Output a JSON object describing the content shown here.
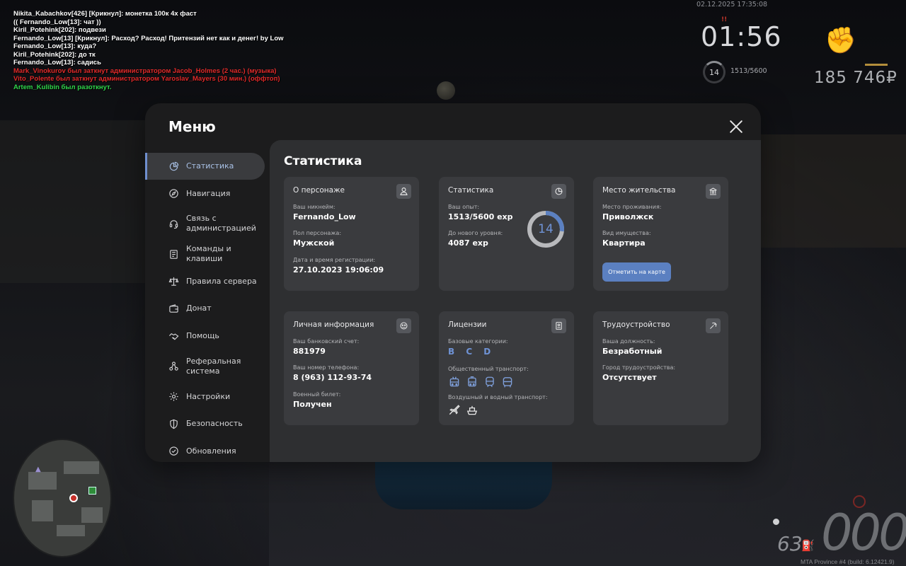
{
  "chat": [
    {
      "text": "Nikita_Kabachkov[426] [Крикнул]: монетка 100к 4х фаст",
      "color": "#ffffff"
    },
    {
      "text": "(( Fernando_Low[13]: чат ))",
      "color": "#ffffff"
    },
    {
      "text": "Kiril_Potehink[202]: подвези",
      "color": "#ffffff"
    },
    {
      "text": "Fernando_Low[13] [Крикнул]: Расход? Расход! Притензий нет как и денег! by Low",
      "color": "#ffffff"
    },
    {
      "text": "Fernando_Low[13]: куда?",
      "color": "#ffffff"
    },
    {
      "text": "Kiril_Potehink[202]: до тк",
      "color": "#ffffff"
    },
    {
      "text": "Fernando_Low[13]: садись",
      "color": "#ffffff"
    },
    {
      "text": "Mark_Vinokurov был заткнут администратором Jacob_Holmes (2 час.) (музыка)",
      "color": "#e02a2a"
    },
    {
      "text": "Vito_Polente был заткнут администратором Yaroslav_Mayers (30 мин.) (оффтоп)",
      "color": "#e02a2a"
    },
    {
      "text": "Artem_Kulibin был разоткнут.",
      "color": "#2fd64b"
    }
  ],
  "hud": {
    "datetime": "02.12.2025 17:35:08",
    "time": "01:56",
    "level": "14",
    "exp": "1513/5600",
    "money": "185 746₽",
    "fuel": "63",
    "speed": "000",
    "build": "MTA Province #4 (build: 6.12421.9)"
  },
  "menu": {
    "title": "Меню",
    "nav": [
      {
        "label": "Статистика",
        "icon": "pie-chart-icon",
        "active": true
      },
      {
        "label": "Навигация",
        "icon": "compass-icon"
      },
      {
        "label": "Связь с администрацией",
        "icon": "headset-icon"
      },
      {
        "label": "Команды и клавиши",
        "icon": "document-icon"
      },
      {
        "label": "Правила сервера",
        "icon": "scales-icon"
      },
      {
        "label": "Донат",
        "icon": "wallet-icon"
      },
      {
        "label": "Помощь",
        "icon": "handshake-icon"
      },
      {
        "label": "Реферальная система",
        "icon": "referral-icon"
      },
      {
        "label": "Настройки",
        "icon": "gear-icon"
      },
      {
        "label": "Безопасность",
        "icon": "shield-icon"
      },
      {
        "label": "Обновления",
        "icon": "check-circle-icon"
      }
    ],
    "content_title": "Статистика",
    "about": {
      "title": "О персонаже",
      "nick_label": "Ваш никнейм:",
      "nick": "Fernando_Low",
      "sex_label": "Пол персонажа:",
      "sex": "Мужской",
      "reg_label": "Дата и время регистрации:",
      "reg": "27.10.2023 19:06:09"
    },
    "stats": {
      "title": "Статистика",
      "exp_label": "Ваш опыт:",
      "exp": "1513/5600 exp",
      "next_label": "До нового уровня:",
      "next": "4087 exp",
      "level": "14",
      "progress": 0.27
    },
    "residence": {
      "title": "Место жительства",
      "place_label": "Место проживания:",
      "place": "Приволжск",
      "type_label": "Вид имущества:",
      "type": "Квартира",
      "button": "Отметить на карте"
    },
    "personal": {
      "title": "Личная информация",
      "bank_label": "Ваш банковский счет:",
      "bank": "881979",
      "phone_label": "Ваш номер телефона:",
      "phone": "8 (963) 112-93-74",
      "military_label": "Военный билет:",
      "military": "Получен"
    },
    "licenses": {
      "title": "Лицензии",
      "basic_label": "Базовые категории:",
      "basic": "B C D",
      "public_label": "Общественный транспорт:",
      "public_icons": [
        "trolleybus-icon",
        "tram-icon",
        "train-icon",
        "bus-icon"
      ],
      "air_label": "Воздушный и водный транспорт:",
      "air_icons": [
        "plane-icon",
        "boat-icon"
      ]
    },
    "job": {
      "title": "Трудоустройство",
      "position_label": "Ваша должность:",
      "position": "Безработный",
      "city_label": "Город трудоустройства:",
      "city": "Отсутствует"
    }
  }
}
